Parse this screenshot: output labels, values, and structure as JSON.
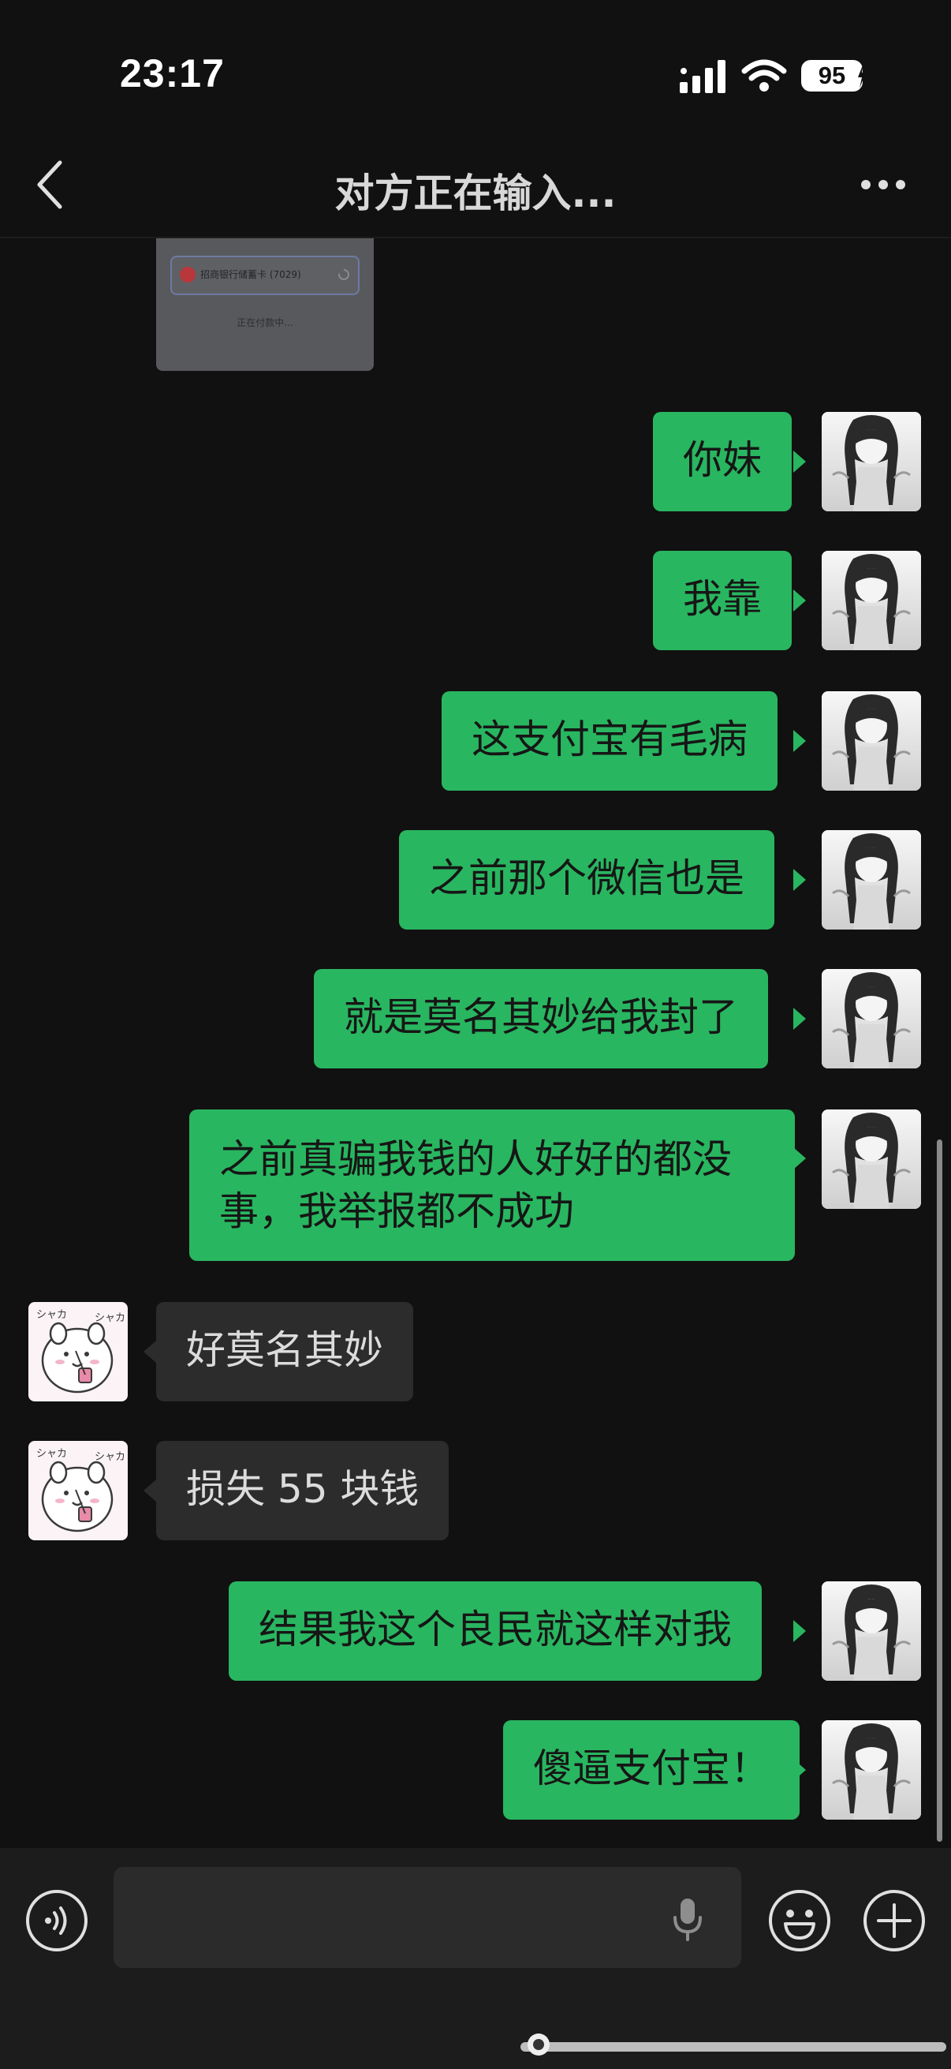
{
  "status_bar": {
    "time": "23:17",
    "battery": "95"
  },
  "nav": {
    "title": "对方正在输入..."
  },
  "image_message": {
    "card_text": "招商银行储蓄卡 (7029)",
    "sub_text": "正在付款中..."
  },
  "messages": [
    {
      "side": "out",
      "text": "你妹"
    },
    {
      "side": "out",
      "text": "我靠"
    },
    {
      "side": "out",
      "text": "这支付宝有毛病"
    },
    {
      "side": "out",
      "text": "之前那个微信也是"
    },
    {
      "side": "out",
      "text": "就是莫名其妙给我封了"
    },
    {
      "side": "out",
      "text": "之前真骗我钱的人好好的都没事，我举报都不成功"
    },
    {
      "side": "in",
      "text": "好莫名其妙"
    },
    {
      "side": "in",
      "text": "损失 55 块钱"
    },
    {
      "side": "out",
      "text": "结果我这个良民就这样对我"
    },
    {
      "side": "out",
      "text": "傻逼支付宝！"
    }
  ],
  "sticker_text": "シャカ",
  "input_bar": {
    "placeholder": ""
  },
  "colors": {
    "background": "#111111",
    "outgoing_bubble": "#29b660",
    "incoming_bubble": "#2c2c2c",
    "input_bar": "#1c1c1c"
  },
  "icons": [
    "back-icon",
    "more-icon",
    "voice-icon",
    "microphone-icon",
    "emoji-icon",
    "plus-icon"
  ]
}
